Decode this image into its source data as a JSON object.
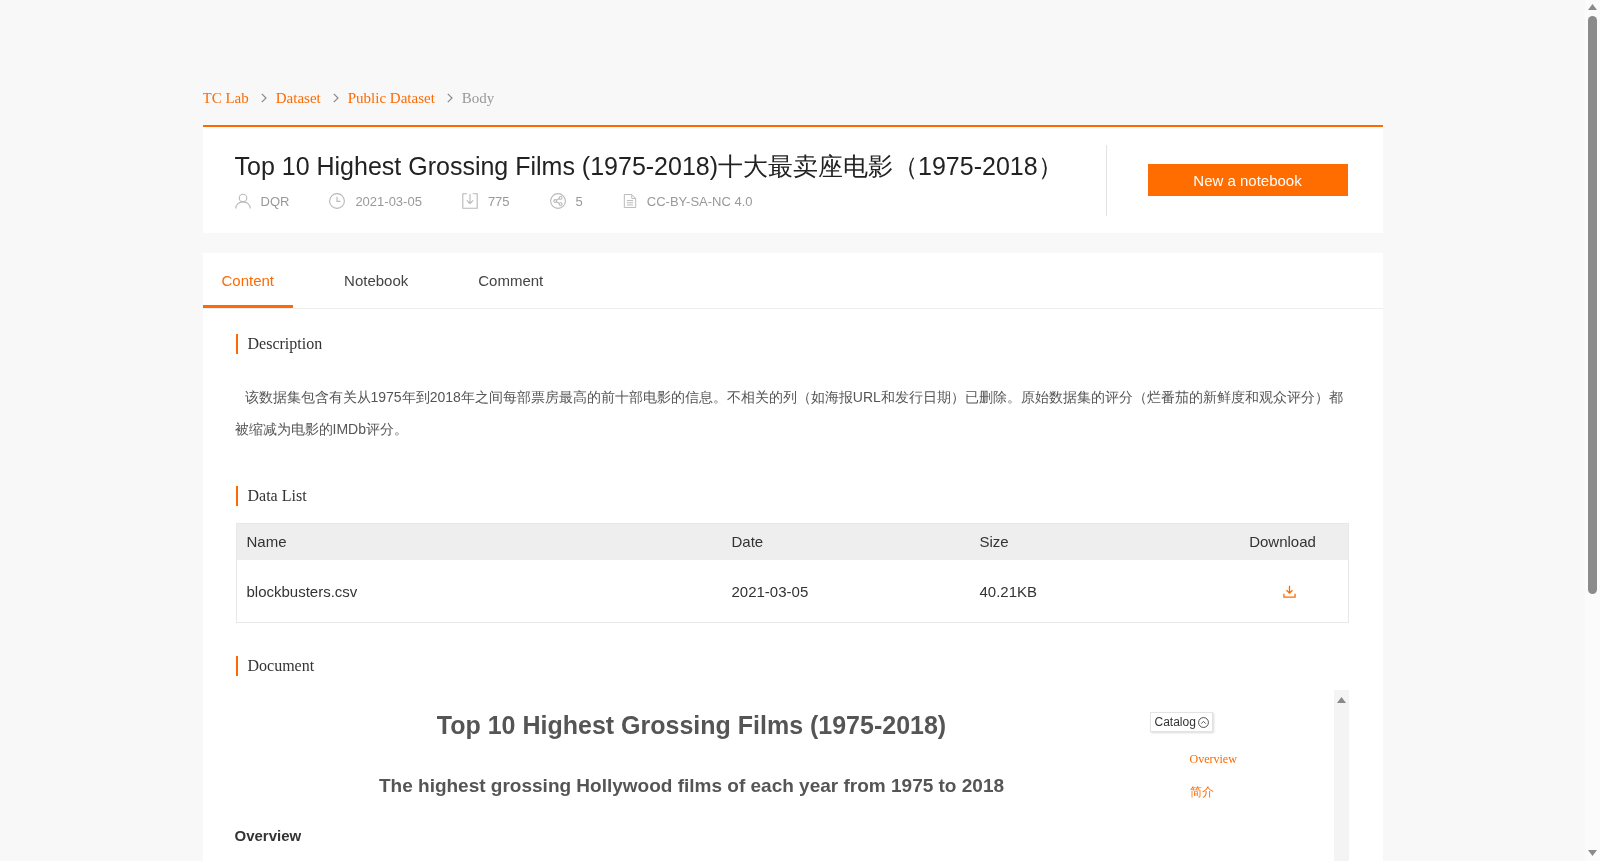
{
  "breadcrumb": [
    {
      "label": "TC Lab",
      "current": false
    },
    {
      "label": "Dataset",
      "current": false
    },
    {
      "label": "Public Dataset",
      "current": false
    },
    {
      "label": "Body",
      "current": true
    }
  ],
  "dataset": {
    "title": "Top 10 Highest Grossing Films (1975-2018)十大最卖座电影（1975-2018）",
    "meta": [
      {
        "kind": "author",
        "text": "DQR"
      },
      {
        "kind": "date",
        "text": "2021-03-05"
      },
      {
        "kind": "downloads",
        "text": "775"
      },
      {
        "kind": "shares",
        "text": "5"
      },
      {
        "kind": "license",
        "text": "CC-BY-SA-NC 4.0"
      }
    ],
    "action": "New a notebook"
  },
  "tabs": [
    {
      "label": "Content",
      "selected": true
    },
    {
      "label": "Notebook",
      "selected": false
    },
    {
      "label": "Comment",
      "selected": false
    }
  ],
  "description": {
    "heading": "Description",
    "text": "该数据集包含有关从1975年到2018年之间每部票房最高的前十部电影的信息。不相关的列（如海报URL和发行日期）已删除。原始数据集的评分（烂番茄的新鲜度和观众评分）都被缩减为电影的IMDb评分。"
  },
  "data_list": {
    "heading": "Data List",
    "columns": [
      "Name",
      "Date",
      "Size",
      "Download"
    ],
    "rows": [
      {
        "name": "blockbusters.csv",
        "date": "2021-03-05",
        "size": "40.21KB"
      }
    ]
  },
  "document": {
    "heading": "Document",
    "title": "Top 10 Highest Grossing Films (1975-2018)",
    "subtitle": "The highest grossing Hollywood films of each year from 1975 to 2018",
    "section": "Overview",
    "catalog": {
      "label": "Catalog",
      "items": [
        "Overview",
        "简介"
      ]
    }
  }
}
